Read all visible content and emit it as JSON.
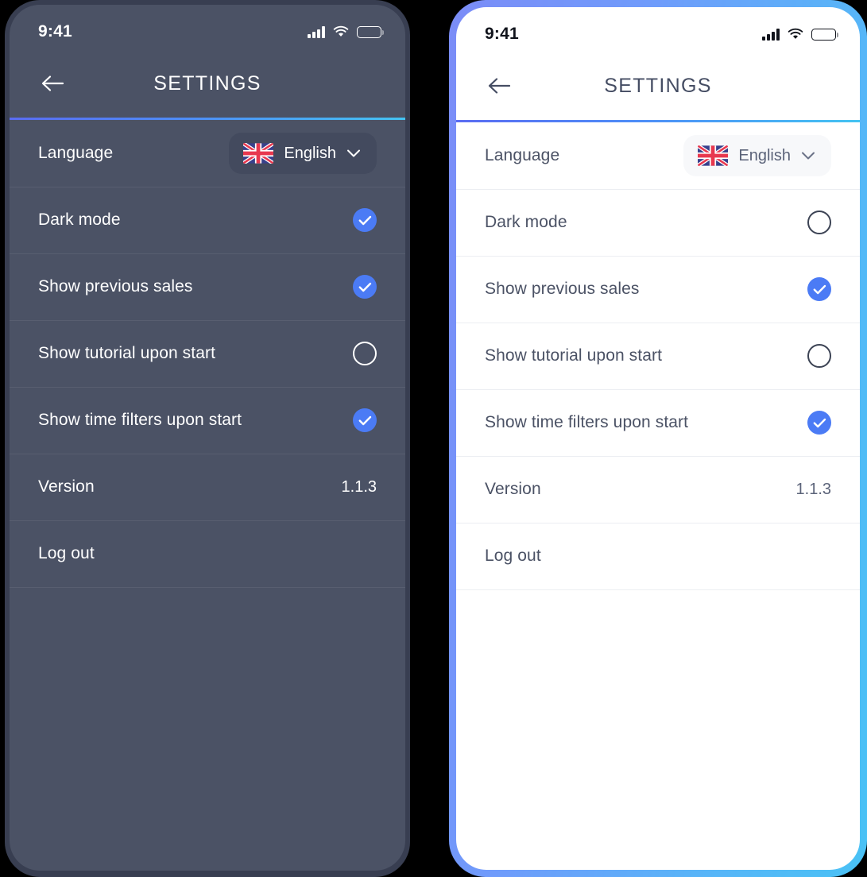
{
  "theme_colors": {
    "dark_screen_bg": "#4b5265",
    "dark_bezel": "#383e51",
    "light_screen_bg": "#ffffff",
    "accent_blue": "#4b7bf5",
    "accent_gradient_start": "#5a6cf2",
    "accent_gradient_end": "#44c3f2",
    "light_border_gradient_start": "#7b8cf7",
    "light_border_gradient_end": "#49c2f5"
  },
  "status_bar": {
    "time": "9:41",
    "signal_icon": "signal-bars-icon",
    "wifi_icon": "wifi-icon",
    "battery_icon": "battery-full-icon"
  },
  "nav": {
    "back_icon": "back-arrow-icon",
    "title": "SETTINGS"
  },
  "language_row": {
    "label": "Language",
    "flag_icon": "uk-flag-icon",
    "value": "English",
    "chevron_icon": "chevron-down-icon"
  },
  "rows_dark": [
    {
      "label": "Dark mode",
      "type": "checkbox",
      "checked": true
    },
    {
      "label": "Show previous sales",
      "type": "checkbox",
      "checked": true
    },
    {
      "label": "Show tutorial upon start",
      "type": "checkbox",
      "checked": false
    },
    {
      "label": "Show time filters upon start",
      "type": "checkbox",
      "checked": true
    },
    {
      "label": "Version",
      "type": "value",
      "value": "1.1.3"
    },
    {
      "label": "Log out",
      "type": "action"
    }
  ],
  "rows_light": [
    {
      "label": "Dark mode",
      "type": "checkbox",
      "checked": false
    },
    {
      "label": "Show previous sales",
      "type": "checkbox",
      "checked": true
    },
    {
      "label": "Show tutorial upon start",
      "type": "checkbox",
      "checked": false
    },
    {
      "label": "Show time filters upon start",
      "type": "checkbox",
      "checked": true
    },
    {
      "label": "Version",
      "type": "value",
      "value": "1.1.3"
    },
    {
      "label": "Log out",
      "type": "action"
    }
  ],
  "labels": {
    "dark_mode": "Dark mode",
    "show_previous_sales": "Show previous sales",
    "show_tutorial": "Show tutorial upon start",
    "show_time_filters": "Show time filters upon start",
    "version": "Version",
    "version_value": "1.1.3",
    "log_out": "Log out"
  }
}
